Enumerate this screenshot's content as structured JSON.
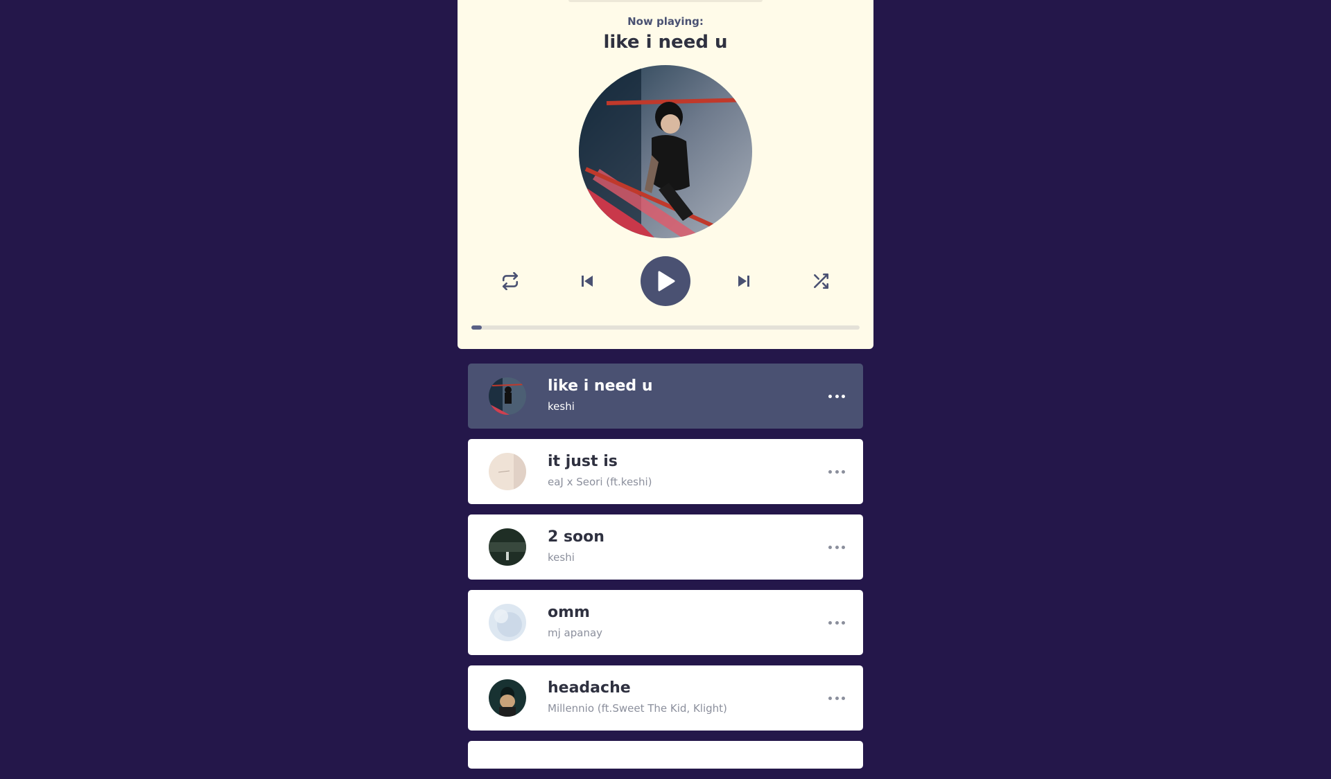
{
  "colors": {
    "background": "#24174a",
    "card": "#fffbe9",
    "accent": "#4a5172",
    "track_bg": "#ffffff"
  },
  "player": {
    "now_playing_label": "Now playing:",
    "title": "like i need u",
    "progress_fraction": 0.027,
    "controls": {
      "repeat_icon": "repeat-icon",
      "prev_icon": "skip-back-icon",
      "play_icon": "play-icon",
      "next_icon": "skip-forward-icon",
      "shuffle_icon": "shuffle-icon"
    }
  },
  "playlist": {
    "tracks": [
      {
        "title": "like i need u",
        "artist": "keshi",
        "active": true
      },
      {
        "title": "it just is",
        "artist": "eaJ x Seori (ft.keshi)",
        "active": false
      },
      {
        "title": "2 soon",
        "artist": "keshi",
        "active": false
      },
      {
        "title": "omm",
        "artist": "mj apanay",
        "active": false
      },
      {
        "title": "headache",
        "artist": "Millennio (ft.Sweet The Kid, Klight)",
        "active": false
      }
    ]
  }
}
